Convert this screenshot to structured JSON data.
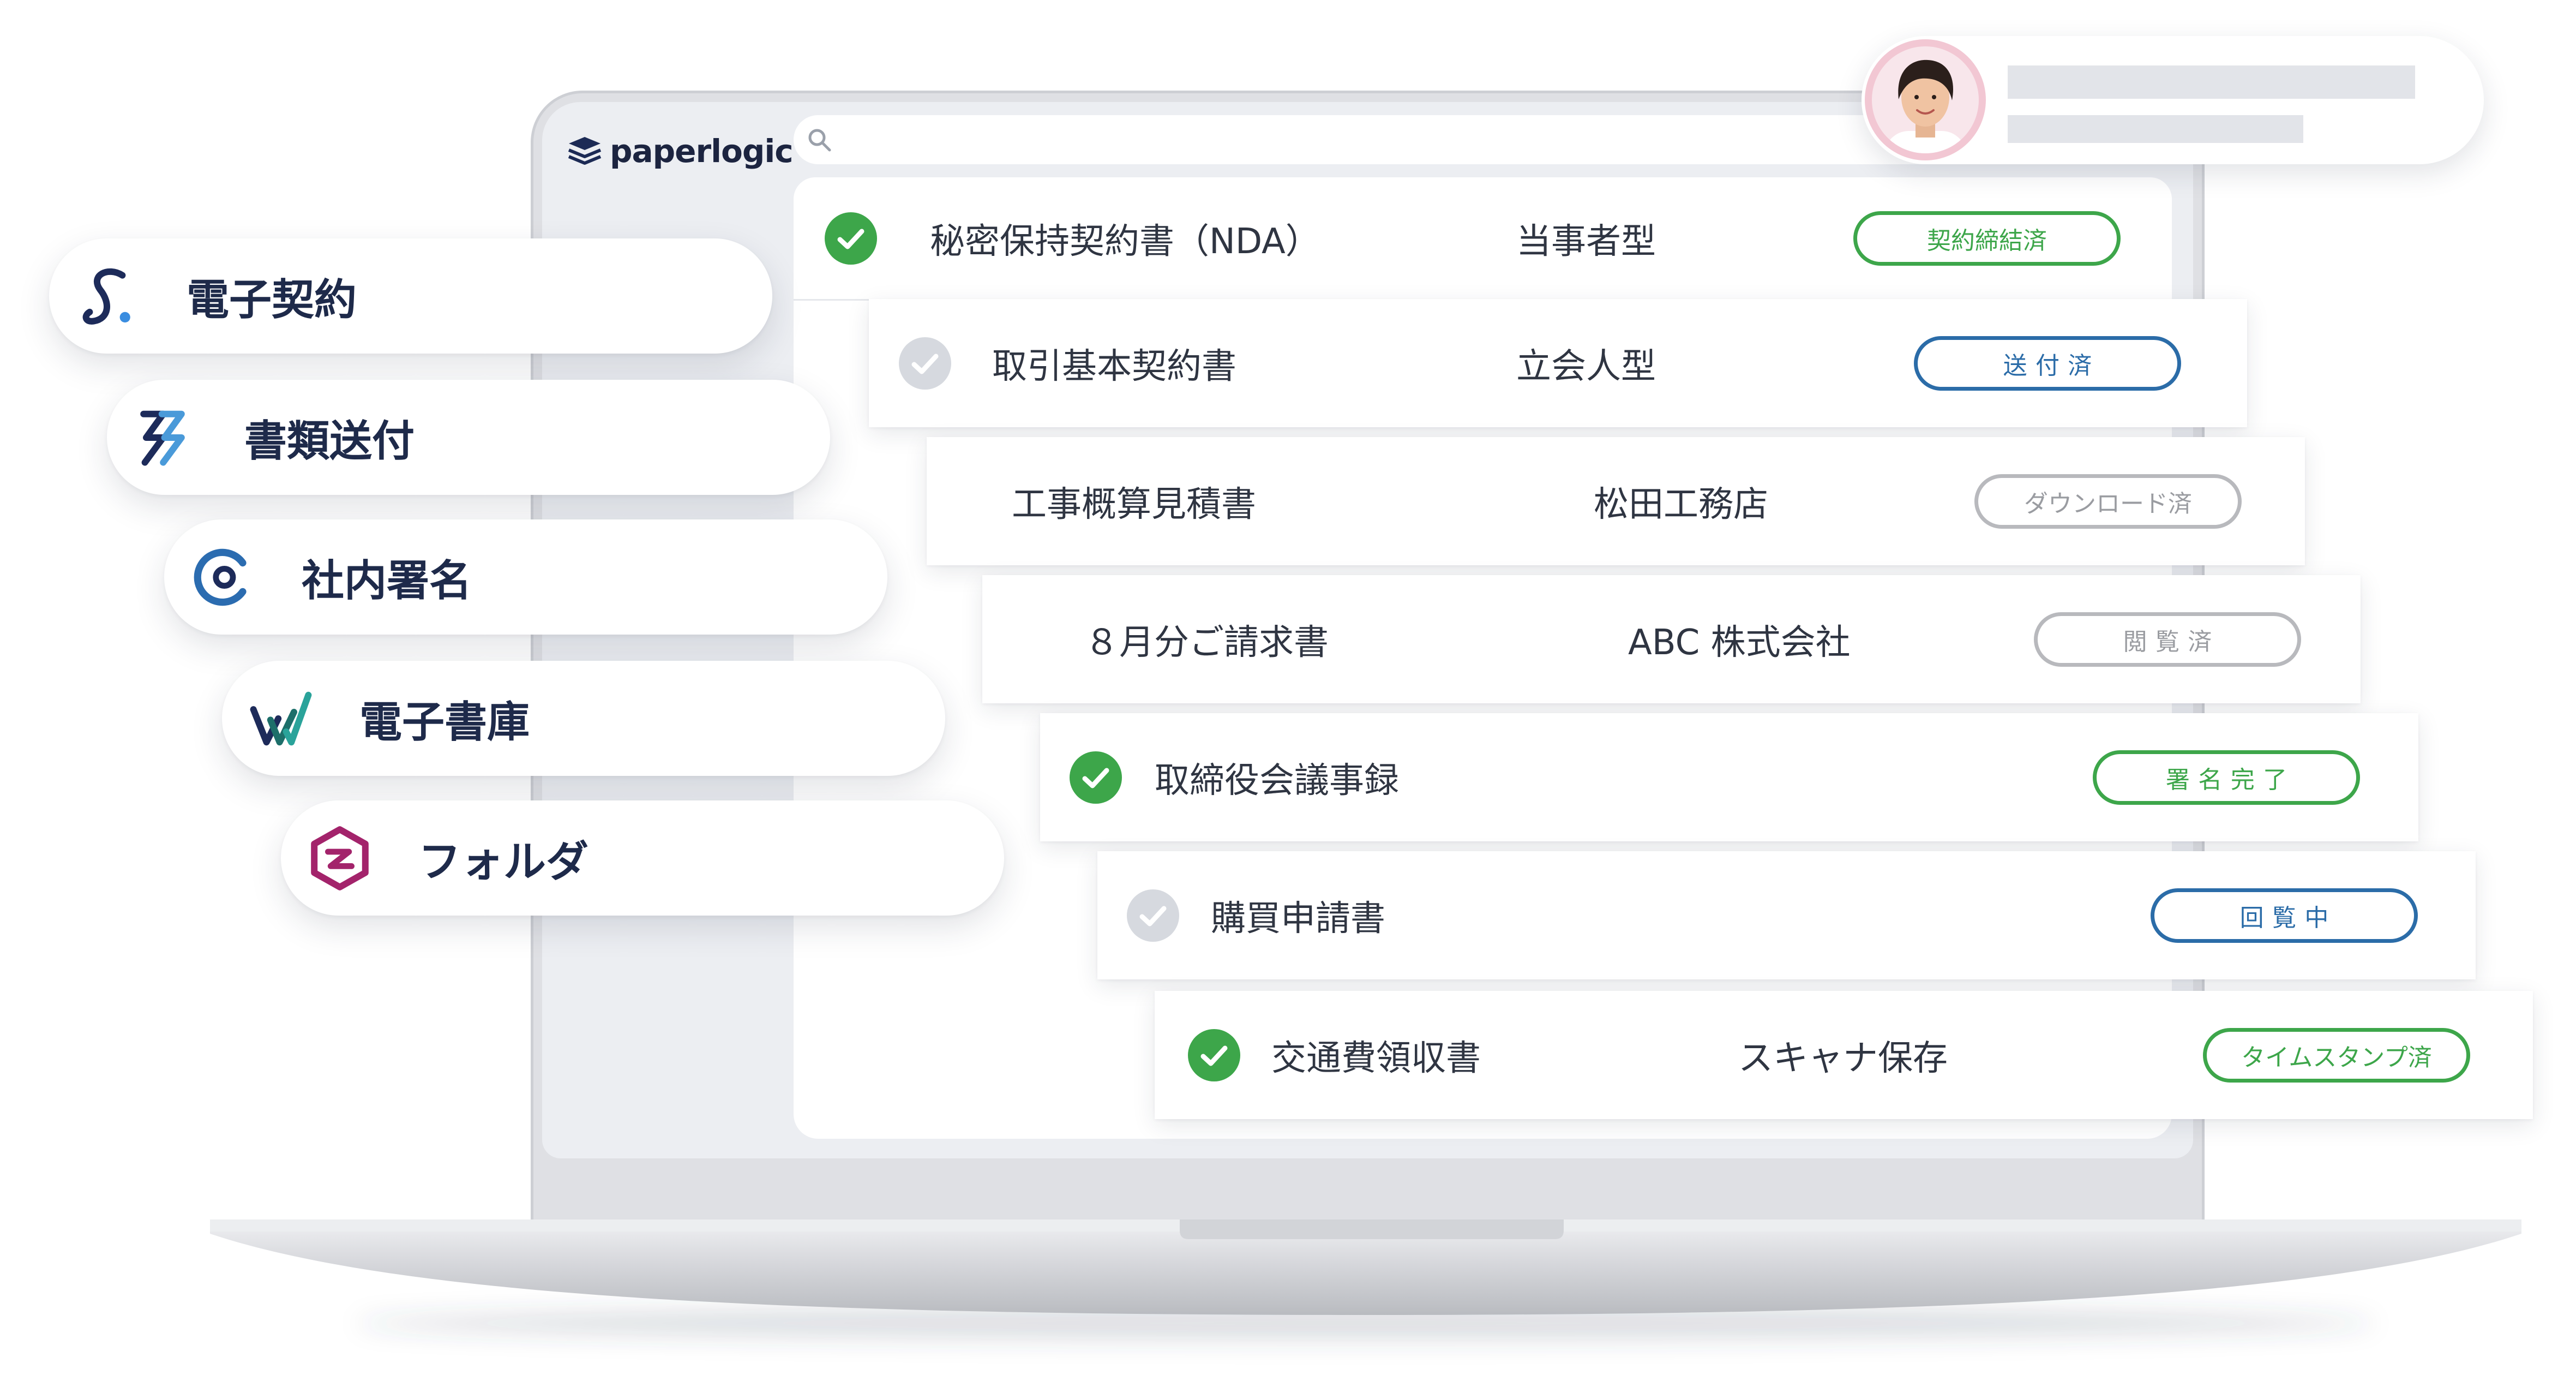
{
  "brand": {
    "logo_text": "paperlogic",
    "logo_icon": "layers-icon"
  },
  "search": {
    "placeholder": "",
    "icon": "search-icon"
  },
  "user": {
    "avatar": "user-avatar"
  },
  "products": [
    {
      "label": "電子契約",
      "icon": "signature-s-icon"
    },
    {
      "label": "書類送付",
      "icon": "send-arrows-icon"
    },
    {
      "label": "社内署名",
      "icon": "circle-seal-icon"
    },
    {
      "label": "電子書庫",
      "icon": "check-archive-icon"
    },
    {
      "label": "フォルダ",
      "icon": "hexagon-folder-icon"
    }
  ],
  "documents": [
    {
      "title": "秘密保持契約書（NDA）",
      "party": "当事者型",
      "status": "契約締結済",
      "status_tone": "green",
      "check": "done"
    },
    {
      "title": "取引基本契約書",
      "party": "立会人型",
      "status": "送付済",
      "status_tone": "blue",
      "check": "pending"
    },
    {
      "title": "工事概算見積書",
      "party": "松田工務店",
      "status": "ダウンロード済",
      "status_tone": "gray",
      "check": "none"
    },
    {
      "title": "８月分ご請求書",
      "party": "ABC 株式会社",
      "status": "閲覧済",
      "status_tone": "gray",
      "check": "none"
    },
    {
      "title": "取締役会議事録",
      "status": "署名完了",
      "status_tone": "green",
      "check": "done"
    },
    {
      "title": "購買申請書",
      "status": "回覧中",
      "status_tone": "blue",
      "check": "pending"
    },
    {
      "title": "交通費領収書",
      "party": "スキャナ保存",
      "status": "タイムスタンプ済",
      "status_tone": "green",
      "check": "done"
    }
  ],
  "colors": {
    "green": "#3da64a",
    "blue": "#2b6ca8",
    "gray": "#b8b9bd",
    "navy": "#1d2b4f",
    "text": "#2f3542"
  }
}
